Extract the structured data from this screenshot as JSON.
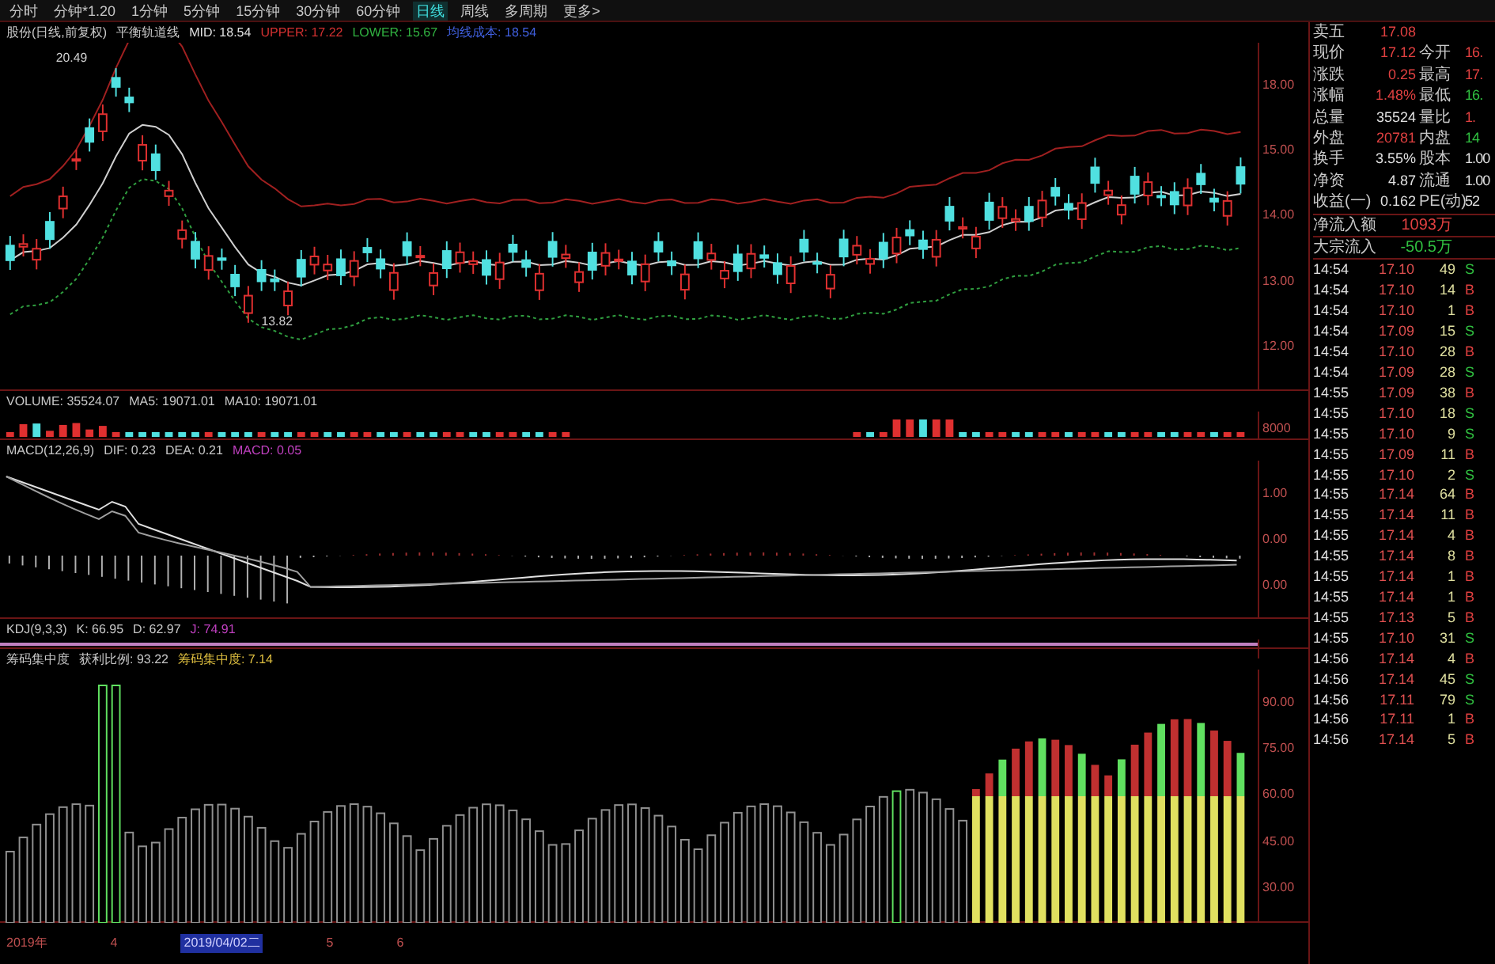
{
  "toolbar": {
    "tabs": [
      {
        "label": "分时",
        "selected": false
      },
      {
        "label": "分钟*1.20",
        "selected": false
      },
      {
        "label": "1分钟",
        "selected": false
      },
      {
        "label": "5分钟",
        "selected": false
      },
      {
        "label": "15分钟",
        "selected": false
      },
      {
        "label": "30分钟",
        "selected": false
      },
      {
        "label": "60分钟",
        "selected": false
      },
      {
        "label": "日线",
        "selected": true
      },
      {
        "label": "周线",
        "selected": false
      },
      {
        "label": "多周期",
        "selected": false
      },
      {
        "label": "更多>",
        "selected": false
      }
    ]
  },
  "price_panel": {
    "legend": [
      {
        "text": "股份(日线,前复权)",
        "color": "#c8c8c8"
      },
      {
        "text": "平衡轨道线",
        "color": "#c8c8c8"
      },
      {
        "text": "MID: 18.54",
        "color": "#e0e0e0"
      },
      {
        "text": "UPPER: 17.22",
        "color": "#d03030"
      },
      {
        "text": "LOWER: 15.67",
        "color": "#30b040"
      },
      {
        "text": "均线成本: 18.54",
        "color": "#4060e0"
      }
    ],
    "high_label": "20.49",
    "low_label": "13.82",
    "axis_labels": [
      "18.00",
      "15.00",
      "14.00",
      "13.00",
      "12.00"
    ]
  },
  "volume_panel": {
    "legend": [
      {
        "text": "VOLUME: 35524.07",
        "color": "#c8c8c8"
      },
      {
        "text": "MA5: 19071.01",
        "color": "#c8c8c8"
      },
      {
        "text": "MA10: 19071.01",
        "color": "#c8c8c8"
      }
    ],
    "axis_labels": [
      "8000"
    ]
  },
  "macd_panel": {
    "legend": [
      {
        "text": "MACD(12,26,9)",
        "color": "#c8c8c8"
      },
      {
        "text": "DIF: 0.23",
        "color": "#c8c8c8"
      },
      {
        "text": "DEA: 0.21",
        "color": "#c8c8c8"
      },
      {
        "text": "MACD: 0.05",
        "color": "#c040c0"
      }
    ],
    "axis_labels": [
      "1.00",
      "0.00",
      "0.00"
    ]
  },
  "kdj_panel": {
    "legend": [
      {
        "text": "KDJ(9,3,3)",
        "color": "#c8c8c8"
      },
      {
        "text": "K: 66.95",
        "color": "#c8c8c8"
      },
      {
        "text": "D: 62.97",
        "color": "#c8c8c8"
      },
      {
        "text": "J: 74.91",
        "color": "#c040c0"
      }
    ]
  },
  "chip_panel": {
    "legend": [
      {
        "text": "筹码集中度",
        "color": "#c8c8c8"
      },
      {
        "text": "获利比例: 93.22",
        "color": "#c8c8c8"
      },
      {
        "text": "筹码集中度: 7.14",
        "color": "#e0c040"
      }
    ],
    "axis_labels": [
      "90.00",
      "75.00",
      "60.00",
      "45.00",
      "30.00"
    ]
  },
  "date_bar": [
    {
      "text": "2019年",
      "selected": false
    },
    {
      "text": "4",
      "selected": false
    },
    {
      "text": "2019/04/02二",
      "selected": true
    },
    {
      "text": "5",
      "selected": false
    },
    {
      "text": "6",
      "selected": false
    }
  ],
  "quote": [
    {
      "cells": [
        {
          "label": "卖五",
          "value": "17.08",
          "color": "#e04040"
        }
      ]
    },
    {
      "cells": [
        {
          "label": "现价",
          "value": "17.12",
          "color": "#e04040"
        },
        {
          "label": "今开",
          "value": "16.",
          "color": "#e04040"
        }
      ]
    },
    {
      "cells": [
        {
          "label": "涨跌",
          "value": "0.25",
          "color": "#e04040"
        },
        {
          "label": "最高",
          "value": "17.",
          "color": "#e04040"
        }
      ]
    },
    {
      "cells": [
        {
          "label": "涨幅",
          "value": "1.48%",
          "color": "#e04040"
        },
        {
          "label": "最低",
          "value": "16.",
          "color": "#30c040"
        }
      ]
    },
    {
      "cells": [
        {
          "label": "总量",
          "value": "35524",
          "color": "#e0e0e0"
        },
        {
          "label": "量比",
          "value": "1.",
          "color": "#e04040"
        }
      ]
    },
    {
      "cells": [
        {
          "label": "外盘",
          "value": "20781",
          "color": "#e04040"
        },
        {
          "label": "内盘",
          "value": "14",
          "color": "#30c040"
        }
      ]
    },
    {
      "cells": [
        {
          "label": "换手",
          "value": "3.55%",
          "color": "#e0e0e0"
        },
        {
          "label": "股本",
          "value": "1.00",
          "color": "#e0e0e0"
        }
      ]
    },
    {
      "cells": [
        {
          "label": "净资",
          "value": "4.87",
          "color": "#e0e0e0"
        },
        {
          "label": "流通",
          "value": "1.00",
          "color": "#e0e0e0"
        }
      ]
    },
    {
      "cells": [
        {
          "label": "收益(一)",
          "value": "0.162",
          "color": "#e0e0e0"
        },
        {
          "label": "PE(动)",
          "value": "52",
          "color": "#e0e0e0"
        }
      ]
    }
  ],
  "flows": [
    {
      "label": "净流入额",
      "value": "1093万",
      "color": "#e04040"
    },
    {
      "label": "大宗流入",
      "value": "-50.5万",
      "color": "#30c040"
    }
  ],
  "ticks": [
    {
      "time": "14:54",
      "price": "17.10",
      "volume": "49",
      "side": "S",
      "color": "#30c040"
    },
    {
      "time": "14:54",
      "price": "17.10",
      "volume": "14",
      "side": "B",
      "color": "#e04040"
    },
    {
      "time": "14:54",
      "price": "17.10",
      "volume": "1",
      "side": "B",
      "color": "#e04040"
    },
    {
      "time": "14:54",
      "price": "17.09",
      "volume": "15",
      "side": "S",
      "color": "#30c040"
    },
    {
      "time": "14:54",
      "price": "17.10",
      "volume": "28",
      "side": "B",
      "color": "#e04040"
    },
    {
      "time": "14:54",
      "price": "17.09",
      "volume": "28",
      "side": "S",
      "color": "#30c040"
    },
    {
      "time": "14:55",
      "price": "17.09",
      "volume": "38",
      "side": "B",
      "color": "#e04040"
    },
    {
      "time": "14:55",
      "price": "17.10",
      "volume": "18",
      "side": "S",
      "color": "#30c040"
    },
    {
      "time": "14:55",
      "price": "17.10",
      "volume": "9",
      "side": "S",
      "color": "#30c040"
    },
    {
      "time": "14:55",
      "price": "17.09",
      "volume": "11",
      "side": "B",
      "color": "#e04040"
    },
    {
      "time": "14:55",
      "price": "17.10",
      "volume": "2",
      "side": "S",
      "color": "#30c040"
    },
    {
      "time": "14:55",
      "price": "17.14",
      "volume": "64",
      "side": "B",
      "color": "#e04040"
    },
    {
      "time": "14:55",
      "price": "17.14",
      "volume": "11",
      "side": "B",
      "color": "#e04040"
    },
    {
      "time": "14:55",
      "price": "17.14",
      "volume": "4",
      "side": "B",
      "color": "#e04040"
    },
    {
      "time": "14:55",
      "price": "17.14",
      "volume": "8",
      "side": "B",
      "color": "#e04040"
    },
    {
      "time": "14:55",
      "price": "17.14",
      "volume": "1",
      "side": "B",
      "color": "#e04040"
    },
    {
      "time": "14:55",
      "price": "17.14",
      "volume": "1",
      "side": "B",
      "color": "#e04040"
    },
    {
      "time": "14:55",
      "price": "17.13",
      "volume": "5",
      "side": "B",
      "color": "#e04040"
    },
    {
      "time": "14:55",
      "price": "17.10",
      "volume": "31",
      "side": "S",
      "color": "#30c040"
    },
    {
      "time": "14:56",
      "price": "17.14",
      "volume": "4",
      "side": "B",
      "color": "#e04040"
    },
    {
      "time": "14:56",
      "price": "17.14",
      "volume": "45",
      "side": "S",
      "color": "#30c040"
    },
    {
      "time": "14:56",
      "price": "17.11",
      "volume": "79",
      "side": "S",
      "color": "#30c040"
    },
    {
      "time": "14:56",
      "price": "17.11",
      "volume": "1",
      "side": "B",
      "color": "#e04040"
    },
    {
      "time": "14:56",
      "price": "17.14",
      "volume": "5",
      "side": "B",
      "color": "#e04040"
    }
  ]
}
